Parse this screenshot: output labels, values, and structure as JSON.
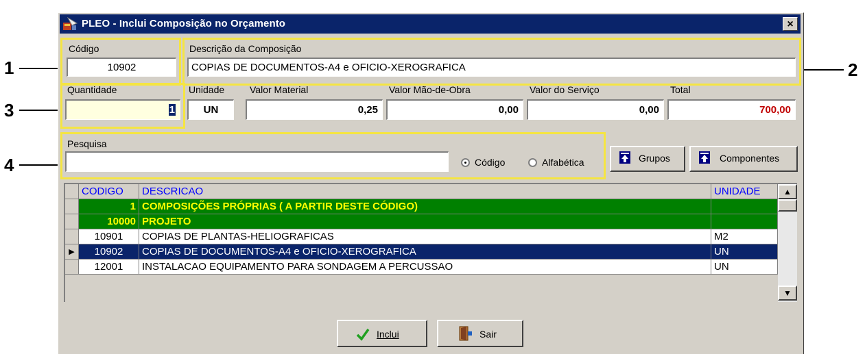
{
  "window": {
    "title": "PLEO - Inclui Composição no Orçamento",
    "close": "×"
  },
  "callouts": [
    "1",
    "2",
    "3",
    "4"
  ],
  "codigo": {
    "label": "Código",
    "value": "10902"
  },
  "descricao": {
    "label": "Descrição da Composição",
    "value": "COPIAS DE DOCUMENTOS-A4 e OFICIO-XEROGRAFICA"
  },
  "quantidade": {
    "label": "Quantidade",
    "value": "1"
  },
  "unidade": {
    "label": "Unidade",
    "value": "UN"
  },
  "valor_material": {
    "label": "Valor Material",
    "value": "0,25"
  },
  "valor_mao_obra": {
    "label": "Valor Mão-de-Obra",
    "value": "0,00"
  },
  "valor_servico": {
    "label": "Valor do Serviço",
    "value": "0,00"
  },
  "total": {
    "label": "Total",
    "value": "700,00",
    "color": "#c00000"
  },
  "pesquisa": {
    "label": "Pesquisa",
    "value": "",
    "radio_codigo": "Código",
    "radio_alfabetica": "Alfabética",
    "selected": "Código"
  },
  "buttons": {
    "grupos": "Grupos",
    "componentes": "Componentes",
    "inclui": "Inclui",
    "sair": "Sair"
  },
  "grid": {
    "columns": [
      "CODIGO",
      "DESCRICAO",
      "UNIDADE"
    ],
    "header_color": "#0000ff",
    "group_bg": "#008000",
    "group_fg": "#ffff00",
    "selected_bg": "#0a246a",
    "rows": [
      {
        "codigo": "1",
        "descricao": "COMPOSIÇÕES PRÓPRIAS ( A PARTIR DESTE CÓDIGO)",
        "unidade": "",
        "type": "group"
      },
      {
        "codigo": "10000",
        "descricao": "PROJETO",
        "unidade": "",
        "type": "group"
      },
      {
        "codigo": "10901",
        "descricao": "COPIAS DE PLANTAS-HELIOGRAFICAS",
        "unidade": "M2",
        "type": "normal"
      },
      {
        "codigo": "10902",
        "descricao": "COPIAS DE DOCUMENTOS-A4 e OFICIO-XEROGRAFICA",
        "unidade": "UN",
        "type": "selected"
      },
      {
        "codigo": "12001",
        "descricao": "INSTALACAO EQUIPAMENTO PARA SONDAGEM A PERCUSSAO",
        "unidade": "UN",
        "type": "normal"
      }
    ]
  }
}
